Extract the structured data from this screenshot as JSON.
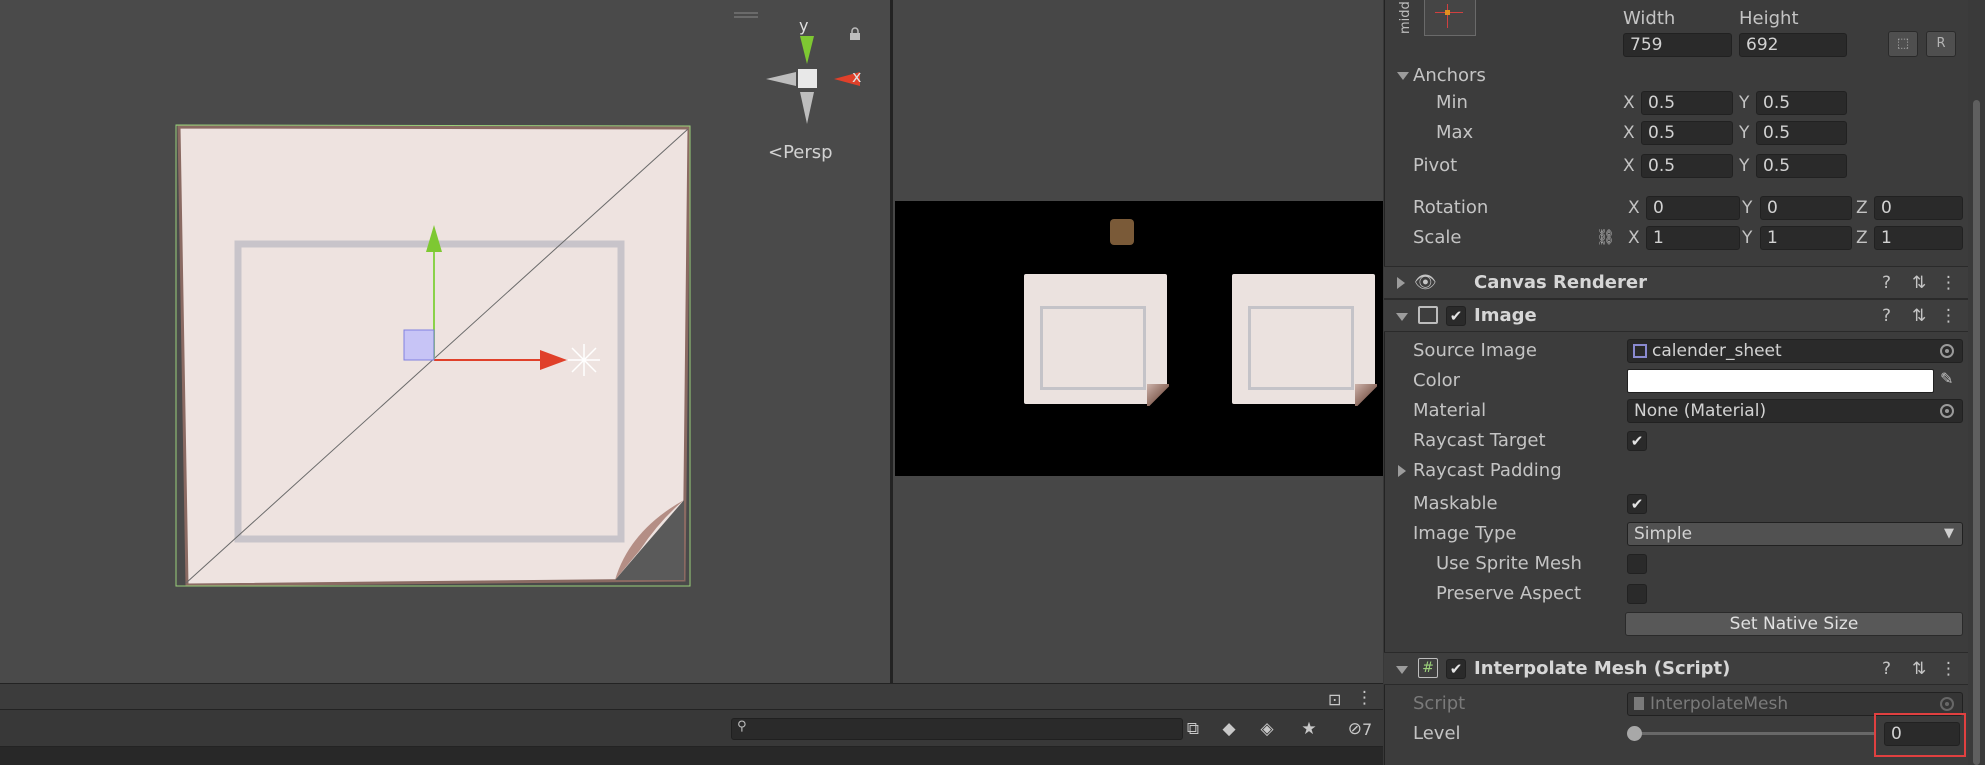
{
  "scene": {
    "gizmo": {
      "y_label": "y",
      "x_label": "x"
    },
    "projection_label": "Persp"
  },
  "bottom_panel": {
    "search_placeholder": "",
    "hidden_count": "7"
  },
  "inspector": {
    "rect_transform": {
      "anchor_preset_label": "midd",
      "width_label": "Width",
      "height_label": "Height",
      "width_value": "759",
      "height_value": "692",
      "raw_edit_label": "R",
      "anchors_label": "Anchors",
      "min_label": "Min",
      "max_label": "Max",
      "pivot_label": "Pivot",
      "rotation_label": "Rotation",
      "scale_label": "Scale",
      "x": "X",
      "y": "Y",
      "z": "Z",
      "anchor_min": {
        "x": "0.5",
        "y": "0.5"
      },
      "anchor_max": {
        "x": "0.5",
        "y": "0.5"
      },
      "pivot": {
        "x": "0.5",
        "y": "0.5"
      },
      "rotation": {
        "x": "0",
        "y": "0",
        "z": "0"
      },
      "scale": {
        "x": "1",
        "y": "1",
        "z": "1"
      }
    },
    "canvas_renderer": {
      "title": "Canvas Renderer"
    },
    "image": {
      "title": "Image",
      "enabled": true,
      "source_image_label": "Source Image",
      "source_image_value": "calender_sheet",
      "color_label": "Color",
      "color_value": "#ffffff",
      "material_label": "Material",
      "material_value": "None (Material)",
      "raycast_target_label": "Raycast Target",
      "raycast_target": true,
      "raycast_padding_label": "Raycast Padding",
      "maskable_label": "Maskable",
      "maskable": true,
      "image_type_label": "Image Type",
      "image_type_value": "Simple",
      "use_sprite_mesh_label": "Use Sprite Mesh",
      "preserve_aspect_label": "Preserve Aspect",
      "set_native_size_label": "Set Native Size"
    },
    "interpolate_mesh": {
      "title": "Interpolate Mesh (Script)",
      "script_label": "Script",
      "script_value": "InterpolateMesh",
      "level_label": "Level",
      "level_value": "0"
    },
    "header_icons": {
      "help": "?",
      "settings": "⇅",
      "menu": "⋮"
    }
  },
  "colors": {
    "scene_bg": "#4a4a4a",
    "inspector_bg": "#3c3c3c",
    "highlight": "#e04040",
    "gizmo_y": "#7ec832",
    "gizmo_x": "#e0402a",
    "paper": "#ebe2df"
  }
}
